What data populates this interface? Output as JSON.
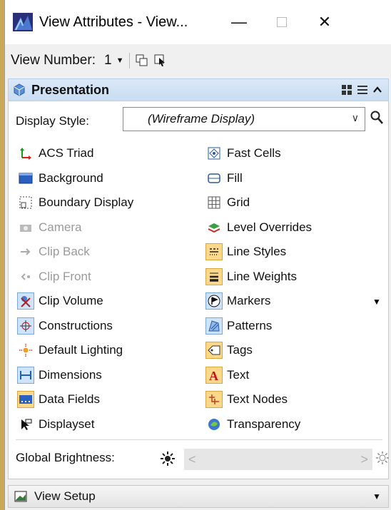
{
  "window": {
    "title": "View Attributes - View...",
    "minimize": "—",
    "close": "✕"
  },
  "toolbar": {
    "view_number_label": "View Number:",
    "view_number_value": "1"
  },
  "presentation": {
    "title": "Presentation",
    "display_style_label": "Display Style:",
    "display_style_value": "(Wireframe Display)",
    "items_left": [
      {
        "label": "ACS Triad",
        "icon": "acs-triad-icon",
        "enabled": true
      },
      {
        "label": "Background",
        "icon": "background-icon",
        "enabled": true
      },
      {
        "label": "Boundary Display",
        "icon": "boundary-display-icon",
        "enabled": true
      },
      {
        "label": "Camera",
        "icon": "camera-icon",
        "enabled": false
      },
      {
        "label": "Clip Back",
        "icon": "clip-back-icon",
        "enabled": false
      },
      {
        "label": "Clip Front",
        "icon": "clip-front-icon",
        "enabled": false
      },
      {
        "label": "Clip Volume",
        "icon": "clip-volume-icon",
        "enabled": true
      },
      {
        "label": "Constructions",
        "icon": "constructions-icon",
        "enabled": true
      },
      {
        "label": "Default Lighting",
        "icon": "default-lighting-icon",
        "enabled": true
      },
      {
        "label": "Dimensions",
        "icon": "dimensions-icon",
        "enabled": true
      },
      {
        "label": "Data Fields",
        "icon": "data-fields-icon",
        "enabled": true
      },
      {
        "label": "Displayset",
        "icon": "displayset-icon",
        "enabled": true
      }
    ],
    "items_right": [
      {
        "label": "Fast Cells",
        "icon": "fast-cells-icon",
        "enabled": true
      },
      {
        "label": "Fill",
        "icon": "fill-icon",
        "enabled": true
      },
      {
        "label": "Grid",
        "icon": "grid-icon",
        "enabled": true
      },
      {
        "label": "Level Overrides",
        "icon": "level-overrides-icon",
        "enabled": true
      },
      {
        "label": "Line Styles",
        "icon": "line-styles-icon",
        "enabled": true
      },
      {
        "label": "Line Weights",
        "icon": "line-weights-icon",
        "enabled": true
      },
      {
        "label": "Markers",
        "icon": "markers-icon",
        "enabled": true
      },
      {
        "label": "Patterns",
        "icon": "patterns-icon",
        "enabled": true
      },
      {
        "label": "Tags",
        "icon": "tags-icon",
        "enabled": true
      },
      {
        "label": "Text",
        "icon": "text-icon",
        "enabled": true
      },
      {
        "label": "Text Nodes",
        "icon": "text-nodes-icon",
        "enabled": true
      },
      {
        "label": "Transparency",
        "icon": "transparency-icon",
        "enabled": true
      }
    ],
    "global_brightness_label": "Global Brightness:"
  },
  "view_setup": {
    "title": "View Setup"
  },
  "colors": {
    "panel_header": "#c8dcf2",
    "toggle_on": "#fbd88a",
    "background": "#c9a85a"
  }
}
